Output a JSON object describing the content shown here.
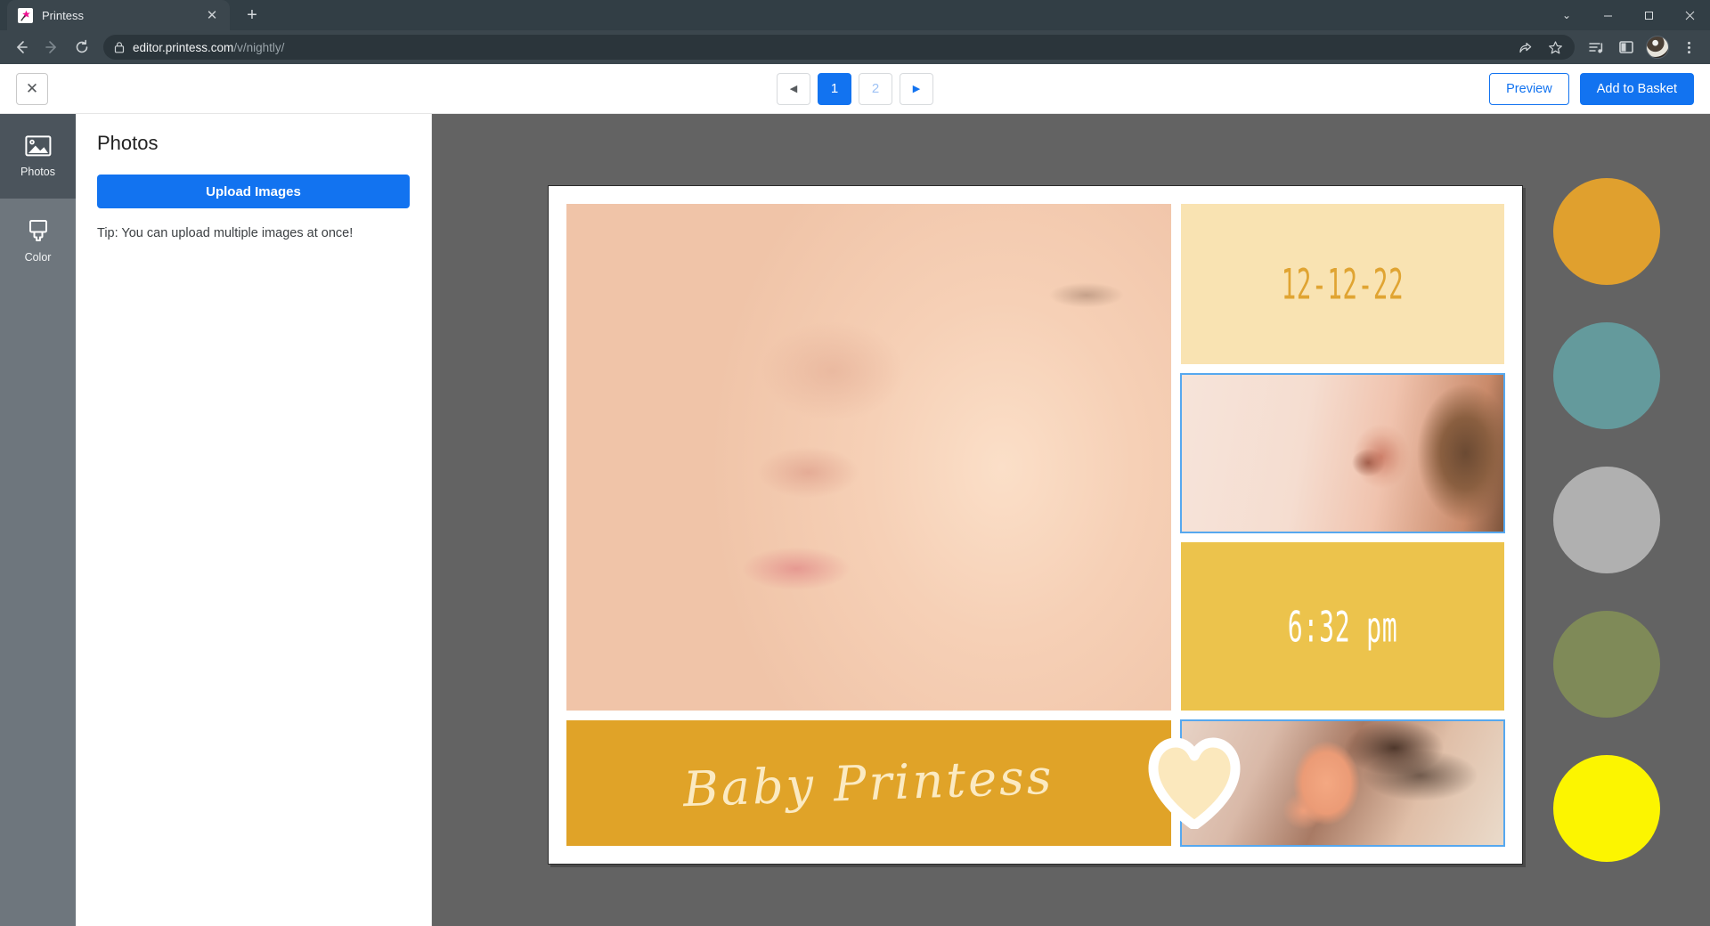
{
  "browser": {
    "tab": {
      "title": "Printess",
      "favicon": "printess-star-icon",
      "close_label": "✕"
    },
    "new_tab_label": "+",
    "window_controls": {
      "minimize": "—",
      "maximize": "❐",
      "close": "✕",
      "chevron": "⌄"
    },
    "nav": {
      "back": "←",
      "forward": "→",
      "reload": "⟳"
    },
    "omnibox": {
      "lock": "lock-icon",
      "url_host": "editor.printess.com",
      "url_path": "/v/nightly/",
      "full_url": "editor.printess.com/v/nightly/"
    },
    "toolbar_icons": [
      "share-icon",
      "bookmark-star-icon",
      "reading-list-icon",
      "sidebar-panel-icon",
      "profile-avatar",
      "more-menu-icon"
    ]
  },
  "header": {
    "close_label": "✕",
    "pager": {
      "prev_label": "◀",
      "next_label": "▶",
      "pages": [
        "1",
        "2"
      ],
      "active_page": "1"
    },
    "preview_label": "Preview",
    "basket_label": "Add to Basket"
  },
  "rail": {
    "items": [
      {
        "label": "Photos",
        "icon": "photo-icon",
        "active": true
      },
      {
        "label": "Color",
        "icon": "paint-bucket-icon",
        "active": false
      }
    ]
  },
  "panel": {
    "title": "Photos",
    "upload_label": "Upload Images",
    "tip": "Tip: You can upload multiple images at once!"
  },
  "design": {
    "date_text": "12-12-22",
    "time_text": "6:32 pm",
    "name_text": "Baby Printess",
    "photos": [
      {
        "name": "baby-face-photo",
        "alt": "Close-up of sleeping baby face",
        "selected": false
      },
      {
        "name": "baby-ear-photo",
        "alt": "Close-up of baby ear",
        "selected": true
      },
      {
        "name": "baby-feet-photo",
        "alt": "Close-up of baby feet",
        "selected": true
      }
    ],
    "heart": "heart-shape",
    "colors": {
      "date_bg": "#f9e3b2",
      "date_fg": "#e0a432",
      "time_bg": "#ecc34c",
      "time_fg": "#ffffff",
      "name_bg": "#e0a328",
      "name_fg": "#fbeac2",
      "selection": "#56a8ef"
    }
  },
  "swatches": [
    {
      "name": "swatch-amber",
      "color": "#e0a02e"
    },
    {
      "name": "swatch-teal",
      "color": "#649a9c"
    },
    {
      "name": "swatch-gray",
      "color": "#b0b0b0"
    },
    {
      "name": "swatch-olive",
      "color": "#7f8a58"
    },
    {
      "name": "swatch-yellow",
      "color": "#fcf500"
    }
  ]
}
